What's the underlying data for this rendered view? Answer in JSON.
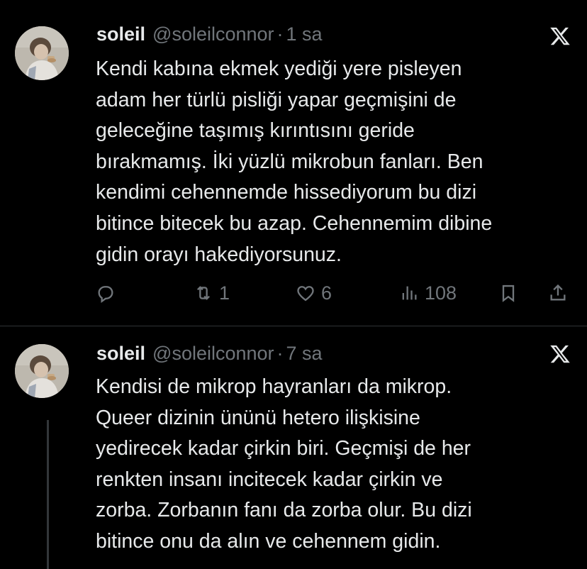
{
  "tweets": [
    {
      "name": "soleil",
      "handle": "@soleilconnor",
      "separator": "·",
      "time": "1 sa",
      "text": "Kendi kabına ekmek yediği yere pisleyen\nadam her türlü pisliği yapar geçmişini de\ngeleceğine taşımış kırıntısını geride\nbırakmamış. İki yüzlü mikrobun fanları. Ben\nkendimi cehennemde hissediyorum bu dizi\nbitince bitecek bu azap. Cehennemim dibine\ngidin orayı hakediyorsunuz.",
      "actions": {
        "reply_count": "",
        "retweet_count": "1",
        "like_count": "6",
        "views_count": "108"
      }
    },
    {
      "name": "soleil",
      "handle": "@soleilconnor",
      "separator": "·",
      "time": "7 sa",
      "text": "Kendisi de mikrop hayranları da mikrop.\nQueer dizinin ününü hetero ilişkisine\nyedirecek kadar çirkin biri. Geçmişi de her\nrenkten insanı incitecek kadar çirkin ve\nzorba. Zorbanın fanı da zorba olur. Bu dizi\nbitince onu da alın ve cehennem gidin."
    }
  ],
  "colors": {
    "background": "#000000",
    "text": "#e7e9ea",
    "secondary": "#71767b",
    "divider": "#2f3336"
  },
  "icons": [
    "x-logo-icon",
    "reply-icon",
    "retweet-icon",
    "like-icon",
    "views-icon",
    "bookmark-icon",
    "share-icon"
  ]
}
